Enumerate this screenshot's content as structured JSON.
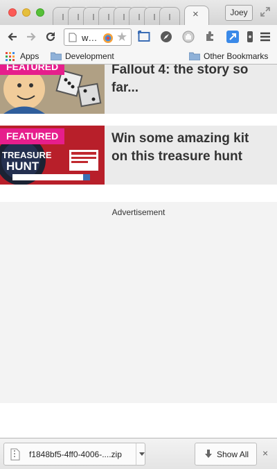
{
  "window": {
    "profile_name": "Joey",
    "tab_close_glyph": "×"
  },
  "toolbar": {
    "url_text": "w…",
    "icons": [
      "back-icon",
      "forward-icon",
      "reload-icon",
      "page-icon",
      "extension-icon",
      "star-icon",
      "cast-icon",
      "compass-icon",
      "hand-icon",
      "puzzle-icon",
      "expand-icon",
      "extension-icon",
      "menu-icon"
    ]
  },
  "bookmarks": {
    "apps_label": "Apps",
    "development_label": "Development",
    "other_label": "Other Bookmarks"
  },
  "articles": [
    {
      "badge": "FEATURED",
      "headline": "Fallout 4: the story so far..."
    },
    {
      "badge": "FEATURED",
      "headline": "Win some amazing kit on this treasure hunt"
    }
  ],
  "ad": {
    "label": "Advertisement"
  },
  "downloads": {
    "file_name": "f1848bf5-4ff0-4006-....zip",
    "show_all_label": "Show All",
    "close_glyph": "×"
  },
  "colors": {
    "badge": "#e61e8c",
    "headline": "#333333",
    "card_bg": "#ebebeb",
    "ad_bg": "#f3f3f3"
  }
}
